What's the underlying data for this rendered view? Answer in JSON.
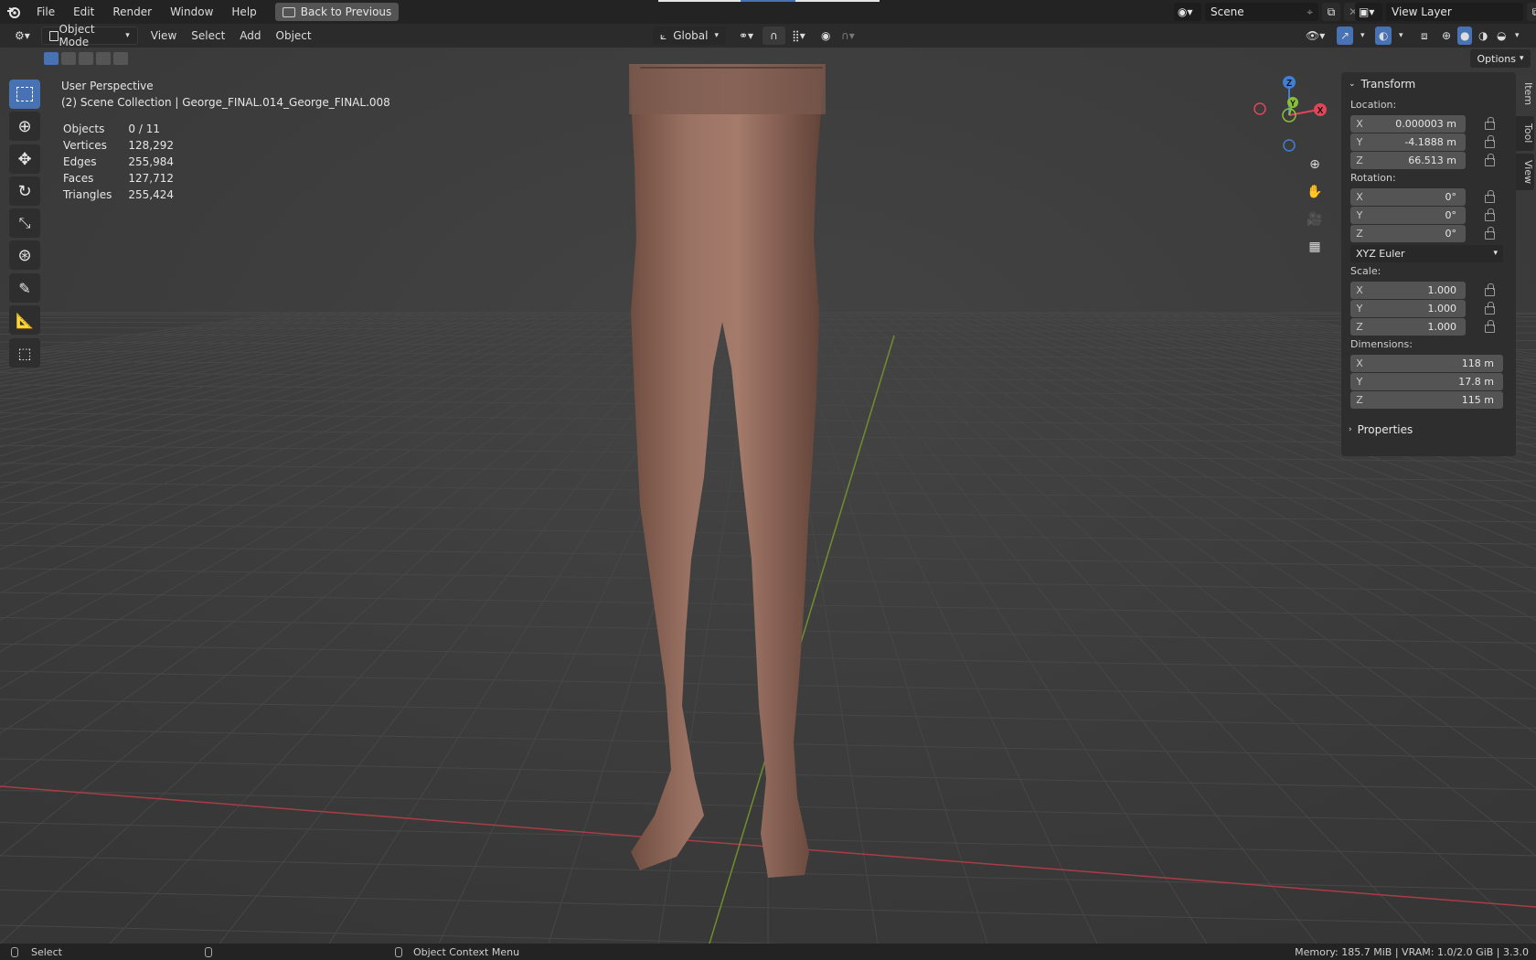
{
  "menu": {
    "items": [
      "File",
      "Edit",
      "Render",
      "Window",
      "Help"
    ],
    "back_button": "Back to Previous",
    "scene": "Scene",
    "view_layer": "View Layer"
  },
  "header": {
    "mode": "Object Mode",
    "menus": [
      "View",
      "Select",
      "Add",
      "Object"
    ],
    "orientation": "Global",
    "options": "Options"
  },
  "overlay": {
    "perspective": "User Perspective",
    "collection": "(2) Scene Collection | George_FINAL.014_George_FINAL.008",
    "stats": [
      {
        "label": "Objects",
        "value": "0 / 11"
      },
      {
        "label": "Vertices",
        "value": "128,292"
      },
      {
        "label": "Edges",
        "value": "255,984"
      },
      {
        "label": "Faces",
        "value": "127,712"
      },
      {
        "label": "Triangles",
        "value": "255,424"
      }
    ]
  },
  "gizmo": {
    "z": "Z",
    "y": "Y",
    "x": "X"
  },
  "npanel": {
    "title": "Transform",
    "location_label": "Location:",
    "location": [
      {
        "axis": "X",
        "value": "0.000003 m"
      },
      {
        "axis": "Y",
        "value": "-4.1888 m"
      },
      {
        "axis": "Z",
        "value": "66.513 m"
      }
    ],
    "rotation_label": "Rotation:",
    "rotation": [
      {
        "axis": "X",
        "value": "0°"
      },
      {
        "axis": "Y",
        "value": "0°"
      },
      {
        "axis": "Z",
        "value": "0°"
      }
    ],
    "rotation_mode": "XYZ Euler",
    "scale_label": "Scale:",
    "scale": [
      {
        "axis": "X",
        "value": "1.000"
      },
      {
        "axis": "Y",
        "value": "1.000"
      },
      {
        "axis": "Z",
        "value": "1.000"
      }
    ],
    "dimensions_label": "Dimensions:",
    "dimensions": [
      {
        "axis": "X",
        "value": "118 m"
      },
      {
        "axis": "Y",
        "value": "17.8 m"
      },
      {
        "axis": "Z",
        "value": "115 m"
      }
    ],
    "properties": "Properties",
    "tabs": [
      "Item",
      "Tool",
      "View"
    ]
  },
  "status": {
    "select": "Select",
    "context": "Object Context Menu",
    "memory": "Memory: 185.7 MiB | VRAM: 1.0/2.0 GiB | 3.3.0"
  },
  "colors": {
    "accent": "#4772b3",
    "x_axis": "#e0455a",
    "y_axis": "#8bbf3a",
    "z_axis": "#3f7fd6"
  }
}
